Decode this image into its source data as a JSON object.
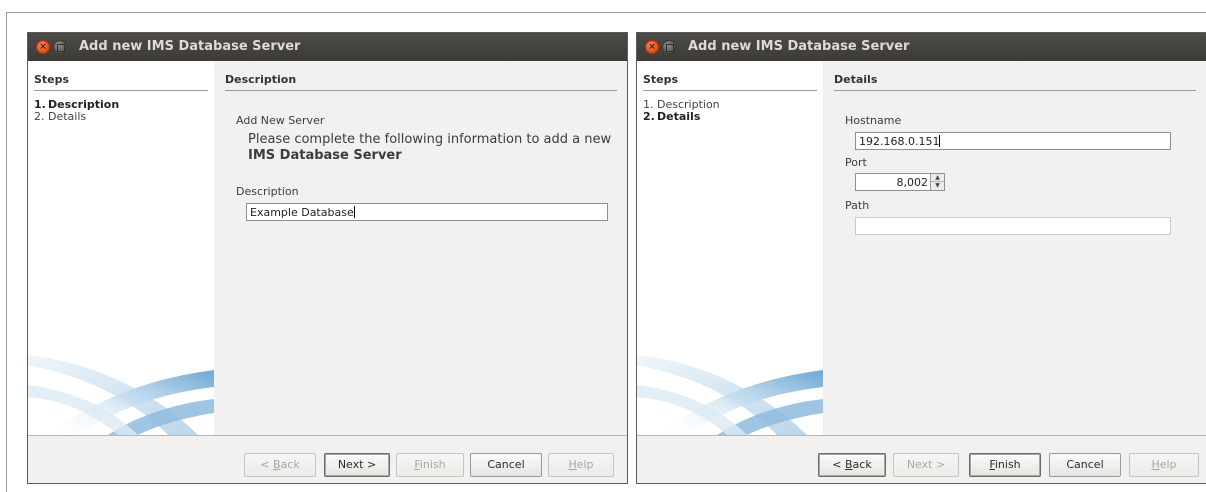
{
  "dialogs": [
    {
      "title": "Add new IMS Database Server",
      "steps_header": "Steps",
      "steps": [
        {
          "num": "1.",
          "label": "Description"
        },
        {
          "num": "2.",
          "label": "Details"
        }
      ],
      "active_step": 1,
      "content_header": "Description",
      "add_new_server_label": "Add New Server",
      "instructions_line1": "Please complete the following information to add a new",
      "instructions_line2": "IMS Database Server",
      "description_label": "Description",
      "description_value": "Example Database",
      "buttons": {
        "back": {
          "pre": "< ",
          "mnemonic": "B",
          "post": "ack",
          "enabled": false
        },
        "next": {
          "label": "Next >",
          "enabled": true
        },
        "finish": {
          "mnemonic": "F",
          "post": "inish",
          "enabled": false
        },
        "cancel": {
          "label": "Cancel",
          "enabled": true
        },
        "help": {
          "mnemonic": "H",
          "post": "elp",
          "enabled": false
        }
      }
    },
    {
      "title": "Add new IMS Database Server",
      "steps_header": "Steps",
      "steps": [
        {
          "num": "1.",
          "label": "Description"
        },
        {
          "num": "2.",
          "label": "Details"
        }
      ],
      "active_step": 2,
      "content_header": "Details",
      "hostname_label": "Hostname",
      "hostname_value": "192.168.0.151",
      "port_label": "Port",
      "port_value": "8,002",
      "path_label": "Path",
      "path_value": "",
      "buttons": {
        "back": {
          "pre": "< ",
          "mnemonic": "B",
          "post": "ack",
          "enabled": true
        },
        "next": {
          "label": "Next >",
          "enabled": false
        },
        "finish": {
          "mnemonic": "F",
          "post": "inish",
          "enabled": true
        },
        "cancel": {
          "label": "Cancel",
          "enabled": true
        },
        "help": {
          "mnemonic": "H",
          "post": "elp",
          "enabled": false
        }
      }
    }
  ],
  "colors": {
    "titlebar": "#3c3b37",
    "close_button": "#df4a16",
    "dialog_bg": "#f2f1f0"
  }
}
